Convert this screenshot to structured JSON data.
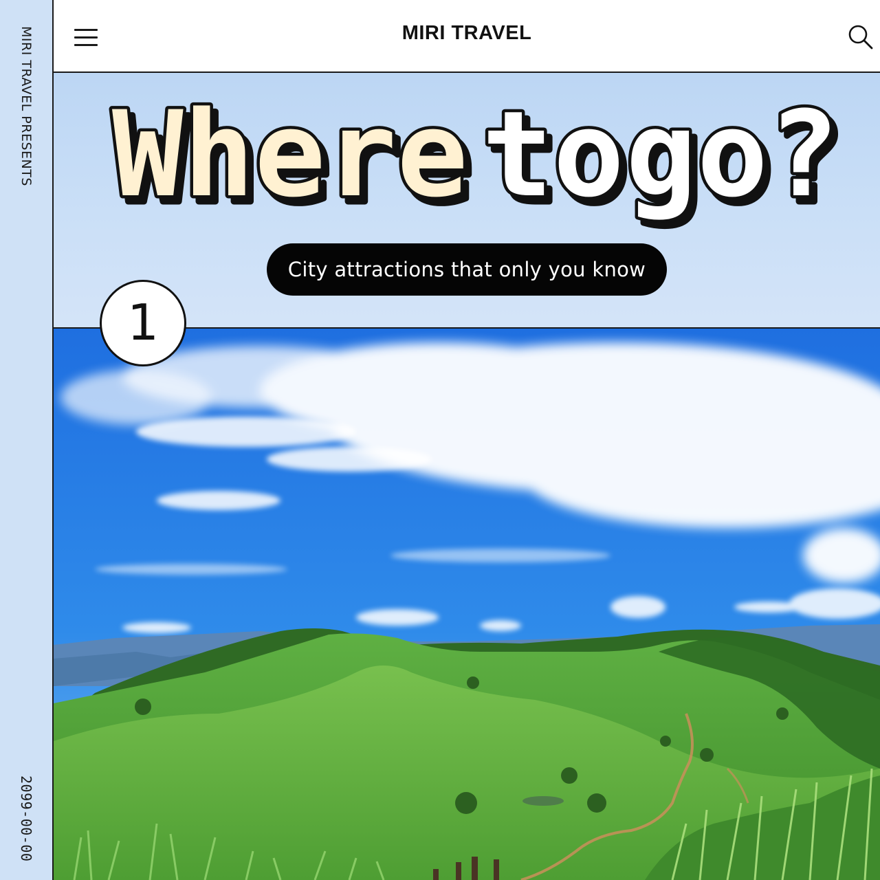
{
  "rail": {
    "top_text": "MIRI TRAVEL PRESENTS",
    "bottom_text": "2099-00-00"
  },
  "header": {
    "brand": "MIRI TRAVEL",
    "menu_icon": "hamburger-menu-icon",
    "search_icon": "search-icon"
  },
  "hero": {
    "headline_words": [
      "Where",
      "to",
      "go?"
    ],
    "subtitle": "City attractions that only you know",
    "badge_number": "1"
  },
  "colors": {
    "hero_background": "#c7dcf4",
    "headline_cream": "#fff1d2",
    "headline_white": "#ffffff",
    "outline": "#111111",
    "pill": "#050505"
  }
}
